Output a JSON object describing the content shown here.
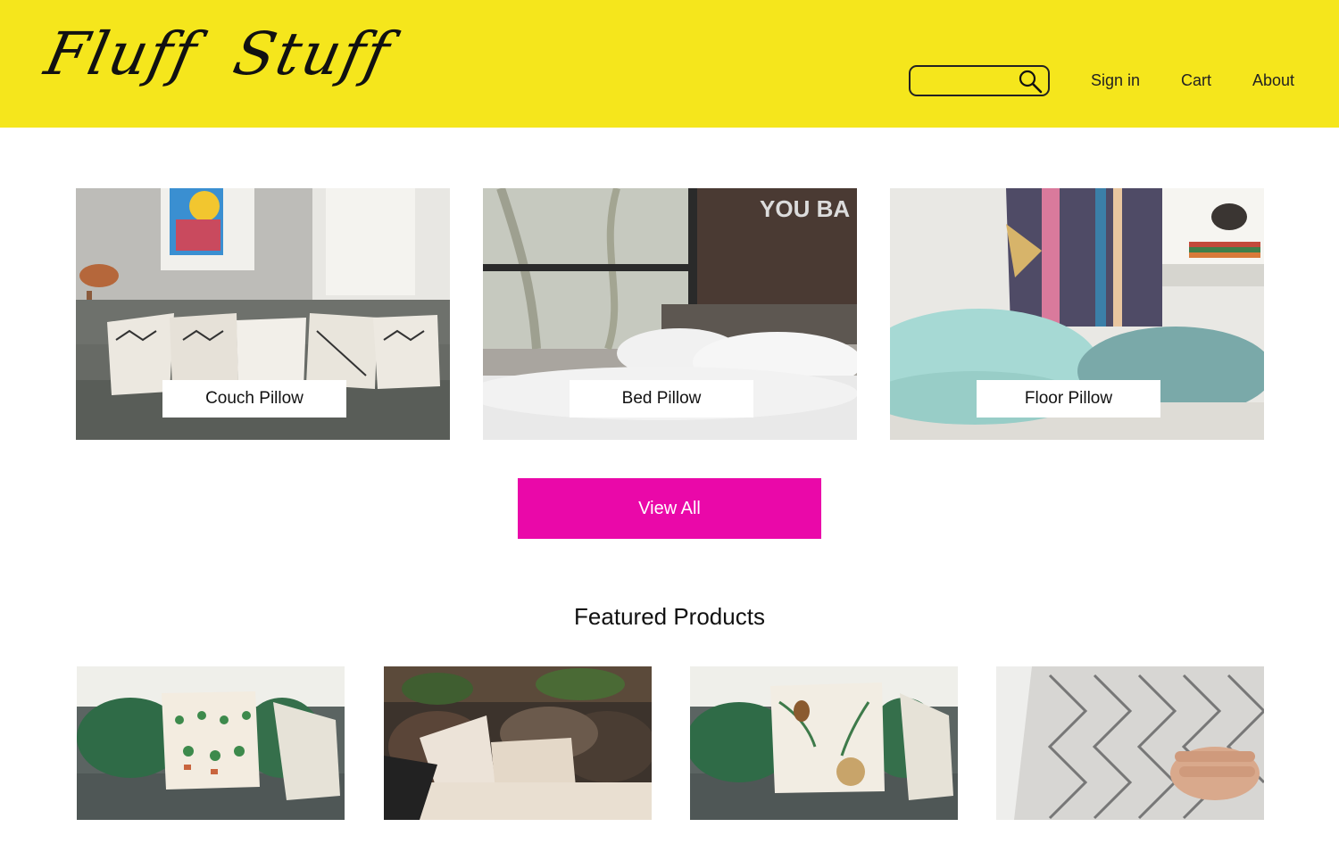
{
  "brand": {
    "name": "Fluff  Stuff"
  },
  "search": {
    "placeholder": "",
    "icon": "search-icon"
  },
  "nav": {
    "sign_in": "Sign in",
    "cart": "Cart",
    "about": "About"
  },
  "categories": [
    {
      "label": "Couch Pillow",
      "image": "couch-pillow-photo"
    },
    {
      "label": "Bed Pillow",
      "image": "bed-pillow-photo"
    },
    {
      "label": "Floor Pillow",
      "image": "floor-pillow-photo"
    }
  ],
  "cta": {
    "view_all": "View All"
  },
  "featured": {
    "title": "Featured Products",
    "products": [
      {
        "image": "cactus-pillow-photo"
      },
      {
        "image": "fluffy-pillows-photo"
      },
      {
        "image": "pinecone-pillow-photo"
      },
      {
        "image": "geometric-pillow-photo"
      }
    ]
  },
  "colors": {
    "header": "#f5e61c",
    "accent": "#ea08a9",
    "text": "#111111"
  }
}
